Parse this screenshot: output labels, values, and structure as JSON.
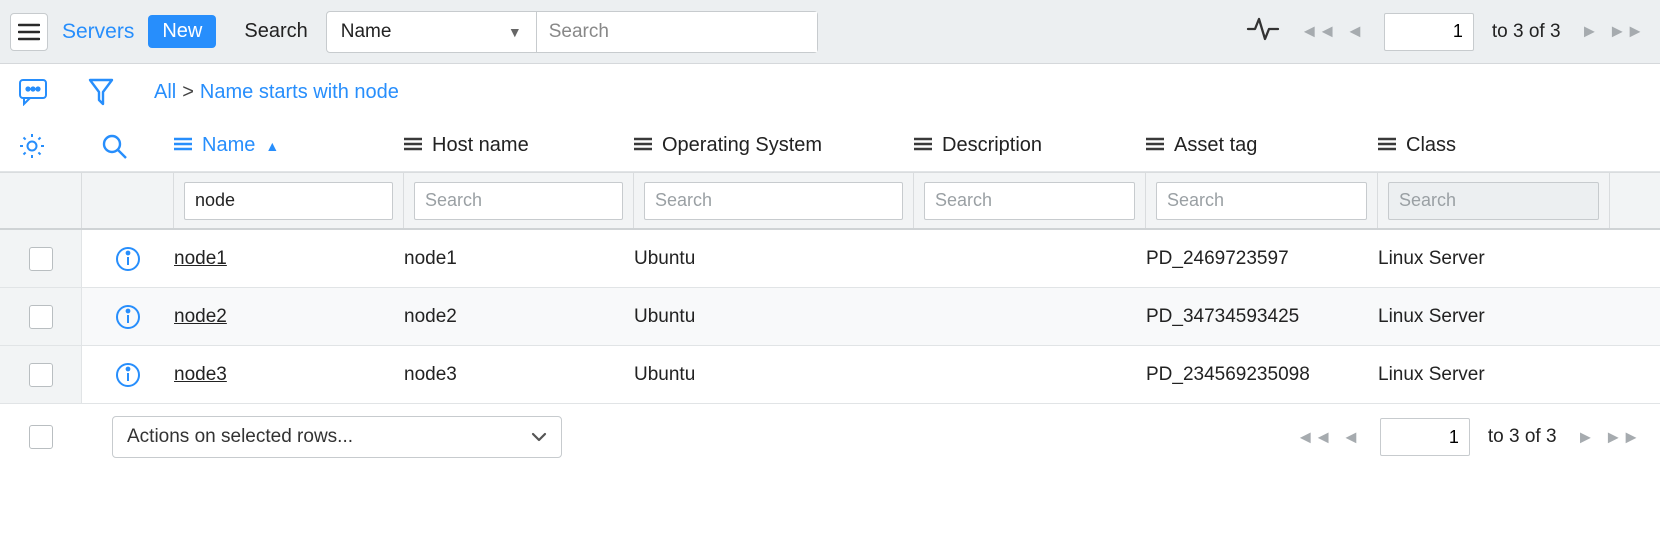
{
  "topbar": {
    "servers_link": "Servers",
    "new_button": "New",
    "search_label": "Search",
    "select_field": "Name",
    "search_placeholder": "Search"
  },
  "pagination": {
    "page_value": "1",
    "range_text": "to 3 of 3"
  },
  "breadcrumb": {
    "all": "All",
    "sep": ">",
    "filter_text": "Name starts with node"
  },
  "columns": [
    {
      "label": "Name",
      "sorted": true
    },
    {
      "label": "Host name"
    },
    {
      "label": "Operating System"
    },
    {
      "label": "Description"
    },
    {
      "label": "Asset tag"
    },
    {
      "label": "Class"
    }
  ],
  "column_filters": {
    "placeholder": "Search",
    "name_value": "node"
  },
  "rows": [
    {
      "name": "node1",
      "host": "node1",
      "os": "Ubuntu",
      "desc": "",
      "asset": "PD_2469723597",
      "class": "Linux Server"
    },
    {
      "name": "node2",
      "host": "node2",
      "os": "Ubuntu",
      "desc": "",
      "asset": "PD_34734593425",
      "class": "Linux Server"
    },
    {
      "name": "node3",
      "host": "node3",
      "os": "Ubuntu",
      "desc": "",
      "asset": "PD_234569235098",
      "class": "Linux Server"
    }
  ],
  "footer": {
    "actions_placeholder": "Actions on selected rows..."
  },
  "colors": {
    "accent": "#278efc"
  }
}
